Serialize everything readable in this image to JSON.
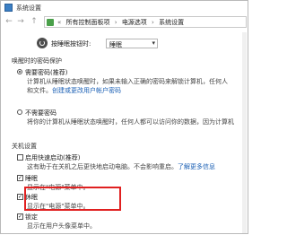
{
  "window": {
    "title": "系统设置"
  },
  "address": {
    "back": "←",
    "forward": "→",
    "up": "↑",
    "crumbs": [
      "«",
      "所有控制面板项",
      "›",
      "电源选项",
      "›",
      "系统设置"
    ]
  },
  "power_button": {
    "label": "按睡眠按钮时:",
    "value": "睡眠"
  },
  "password_section": {
    "title": "唤醒时的密码保护",
    "require": {
      "label": "需要密码(推荐)",
      "desc1": "计算机从睡眠状态唤醒时，如果未输入正确的密码来解锁计算机，任何人",
      "desc2": "和文件。",
      "link": "创建或更改用户帐户密码"
    },
    "norequire": {
      "label": "不需要密码",
      "desc1": "将你的计算机从睡眠状态唤醒时，任何人都可以访问你的数据，因为计算机"
    }
  },
  "shutdown_section": {
    "title": "关机设置",
    "fast_startup": {
      "label": "启用快速启动(推荐)",
      "desc": "这有助于在关机之后更快地启动电脑。不会影响重启。",
      "link": "了解更多信息"
    },
    "sleep": {
      "label": "睡眠",
      "desc": "显示在\"电源\"菜单中。"
    },
    "hibernate": {
      "label": "休眠",
      "desc": "显示在\"电源\"菜单中。"
    },
    "lock": {
      "label": "锁定",
      "desc": "显示在用户头像菜单中。"
    }
  }
}
